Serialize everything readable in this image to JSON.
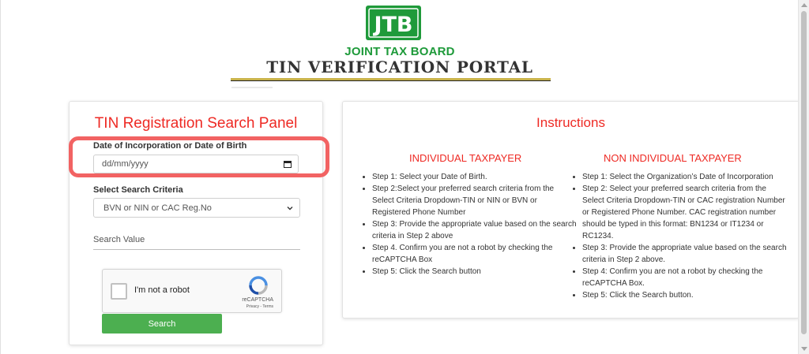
{
  "header": {
    "logo_text": "JTB",
    "board_name": "JOINT TAX BOARD",
    "portal_title": "TIN VERIFICATION PORTAL"
  },
  "search_panel": {
    "title": "TIN Registration Search Panel",
    "date_label": "Date of Incorporation or Date of Birth",
    "date_placeholder": "dd/mm/yyyy",
    "criteria_label": "Select Search Criteria",
    "criteria_selected": "BVN or NIN or CAC Reg.No",
    "search_value_placeholder": "Search Value",
    "recaptcha": {
      "label": "I'm not a robot",
      "brand": "reCAPTCHA",
      "links": "Privacy - Terms"
    },
    "search_button": "Search"
  },
  "instructions": {
    "title": "Instructions",
    "individual": {
      "heading": "INDIVIDUAL TAXPAYER",
      "steps": [
        "Step 1: Select your Date of Birth.",
        "Step 2:Select your preferred search criteria from the Select Criteria Dropdown-TIN or NIN or BVN or Registered Phone Number",
        "Step 3: Provide the appropriate value based on the search criteria in Step 2 above",
        "Step 4. Confirm you are not a robot by checking the reCAPTCHA Box",
        "Step 5: Click the Search button"
      ]
    },
    "non_individual": {
      "heading": "NON INDIVIDUAL TAXPAYER",
      "steps": [
        "Step 1: Select the Organization’s Date of Incorporation",
        "Step 2: Select your preferred search criteria from the Select Criteria Dropdown-TIN or CAC registration Number or Registered Phone Number. CAC registration number should be typed in this format: BN1234 or IT1234 or RC1234.",
        "Step 3: Provide the appropriate value based on the search criteria in Step 2 above.",
        "Step 4: Confirm you are not a robot by checking the reCAPTCHA Box.",
        "Step 5: Click the Search button."
      ]
    }
  },
  "colors": {
    "accent_red": "#ee2a24",
    "brand_green": "#1f9a3a",
    "button_green": "#4caf50",
    "highlight": "#f15b5b"
  }
}
